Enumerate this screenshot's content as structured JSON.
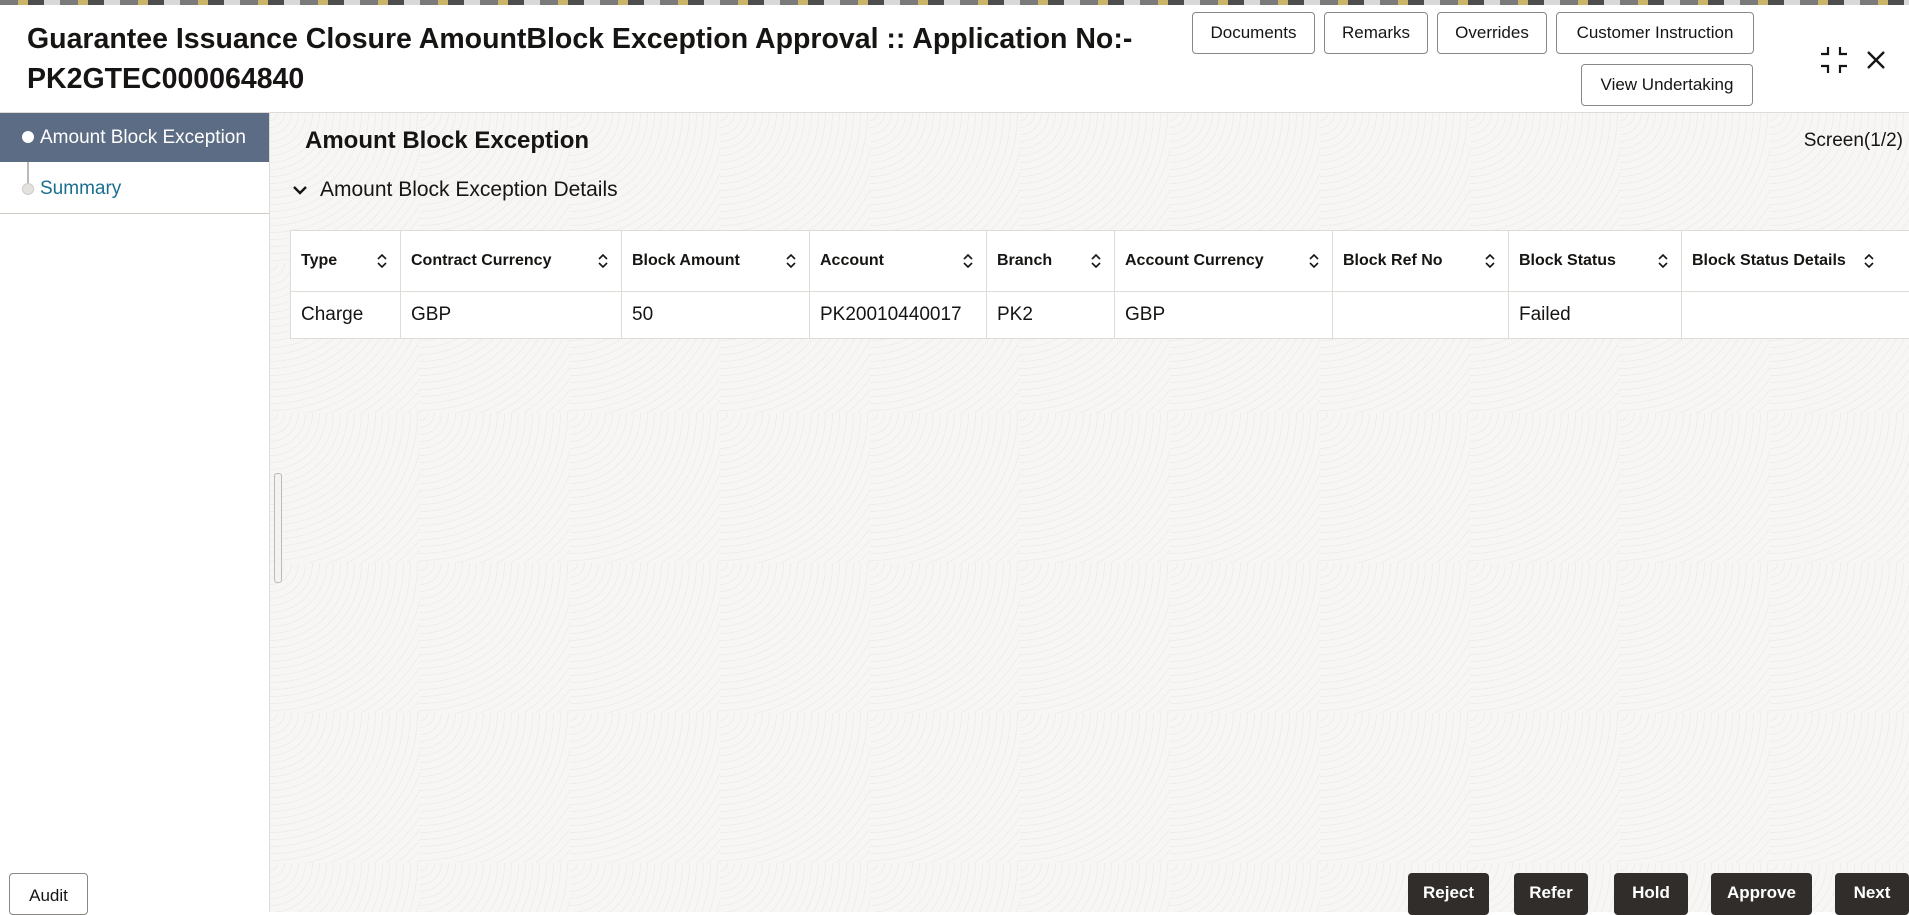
{
  "header": {
    "title_line1": "Guarantee Issuance Closure AmountBlock Exception Approval :: Application No:-",
    "title_line2": "PK2GTEC000064840",
    "buttons": {
      "documents": "Documents",
      "remarks": "Remarks",
      "overrides": "Overrides",
      "customer_instruction": "Customer Instruction",
      "view_undertaking": "View Undertaking"
    },
    "icons": {
      "minimize": "collapse-arrows-icon",
      "close": "close-icon"
    }
  },
  "sidebar": {
    "items": [
      {
        "label": "Amount Block Exception",
        "active": true
      },
      {
        "label": "Summary",
        "active": false
      }
    ]
  },
  "main": {
    "section_title": "Amount Block Exception",
    "screen_indicator": "Screen(1/2)",
    "panel_title": "Amount Block Exception Details",
    "table": {
      "columns": [
        "Type",
        "Contract Currency",
        "Block Amount",
        "Account",
        "Branch",
        "Account Currency",
        "Block Ref No",
        "Block Status",
        "Block Status Details"
      ],
      "rows": [
        [
          "Charge",
          "GBP",
          "50",
          "PK20010440017",
          "PK2",
          "GBP",
          "",
          "Failed",
          ""
        ]
      ]
    }
  },
  "footer": {
    "audit": "Audit",
    "reject": "Reject",
    "refer": "Refer",
    "hold": "Hold",
    "approve": "Approve",
    "next": "Next"
  },
  "colors": {
    "active_nav": "#5b6c84",
    "inactive_nav_text": "#1a6f8f",
    "footer_button": "#312d2a"
  }
}
